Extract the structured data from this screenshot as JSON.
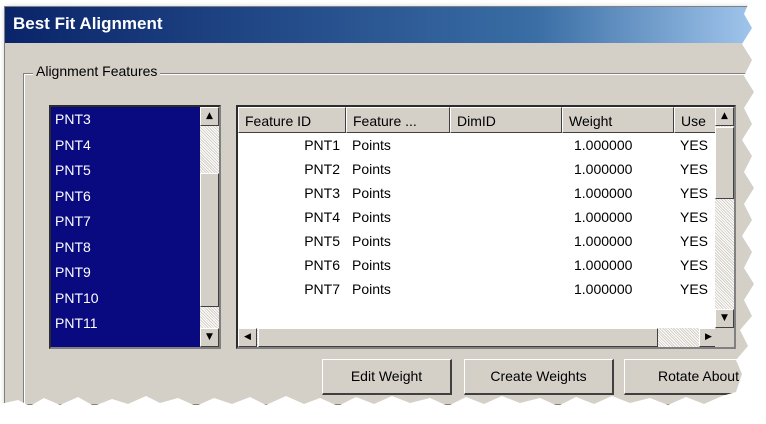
{
  "window": {
    "title": "Best Fit Alignment"
  },
  "group": {
    "label": "Alignment Features"
  },
  "feature_list": {
    "items": [
      "PNT3",
      "PNT4",
      "PNT5",
      "PNT6",
      "PNT7",
      "PNT8",
      "PNT9",
      "PNT10",
      "PNT11"
    ]
  },
  "table": {
    "columns": [
      "Feature ID",
      "Feature ...",
      "DimID",
      "Weight",
      "Use"
    ],
    "rows": [
      [
        "PNT1",
        "Points",
        "",
        "1.000000",
        "YES"
      ],
      [
        "PNT2",
        "Points",
        "",
        "1.000000",
        "YES"
      ],
      [
        "PNT3",
        "Points",
        "",
        "1.000000",
        "YES"
      ],
      [
        "PNT4",
        "Points",
        "",
        "1.000000",
        "YES"
      ],
      [
        "PNT5",
        "Points",
        "",
        "1.000000",
        "YES"
      ],
      [
        "PNT6",
        "Points",
        "",
        "1.000000",
        "YES"
      ],
      [
        "PNT7",
        "Points",
        "",
        "1.000000",
        "YES"
      ]
    ]
  },
  "buttons": {
    "edit_weight": "Edit Weight",
    "create_weights": "Create Weights",
    "rotate_about": "Rotate About"
  },
  "colors": {
    "title_bar": "#0a246a",
    "list_selection": "#0a0a80",
    "dialog_face": "#d4d0c8"
  }
}
